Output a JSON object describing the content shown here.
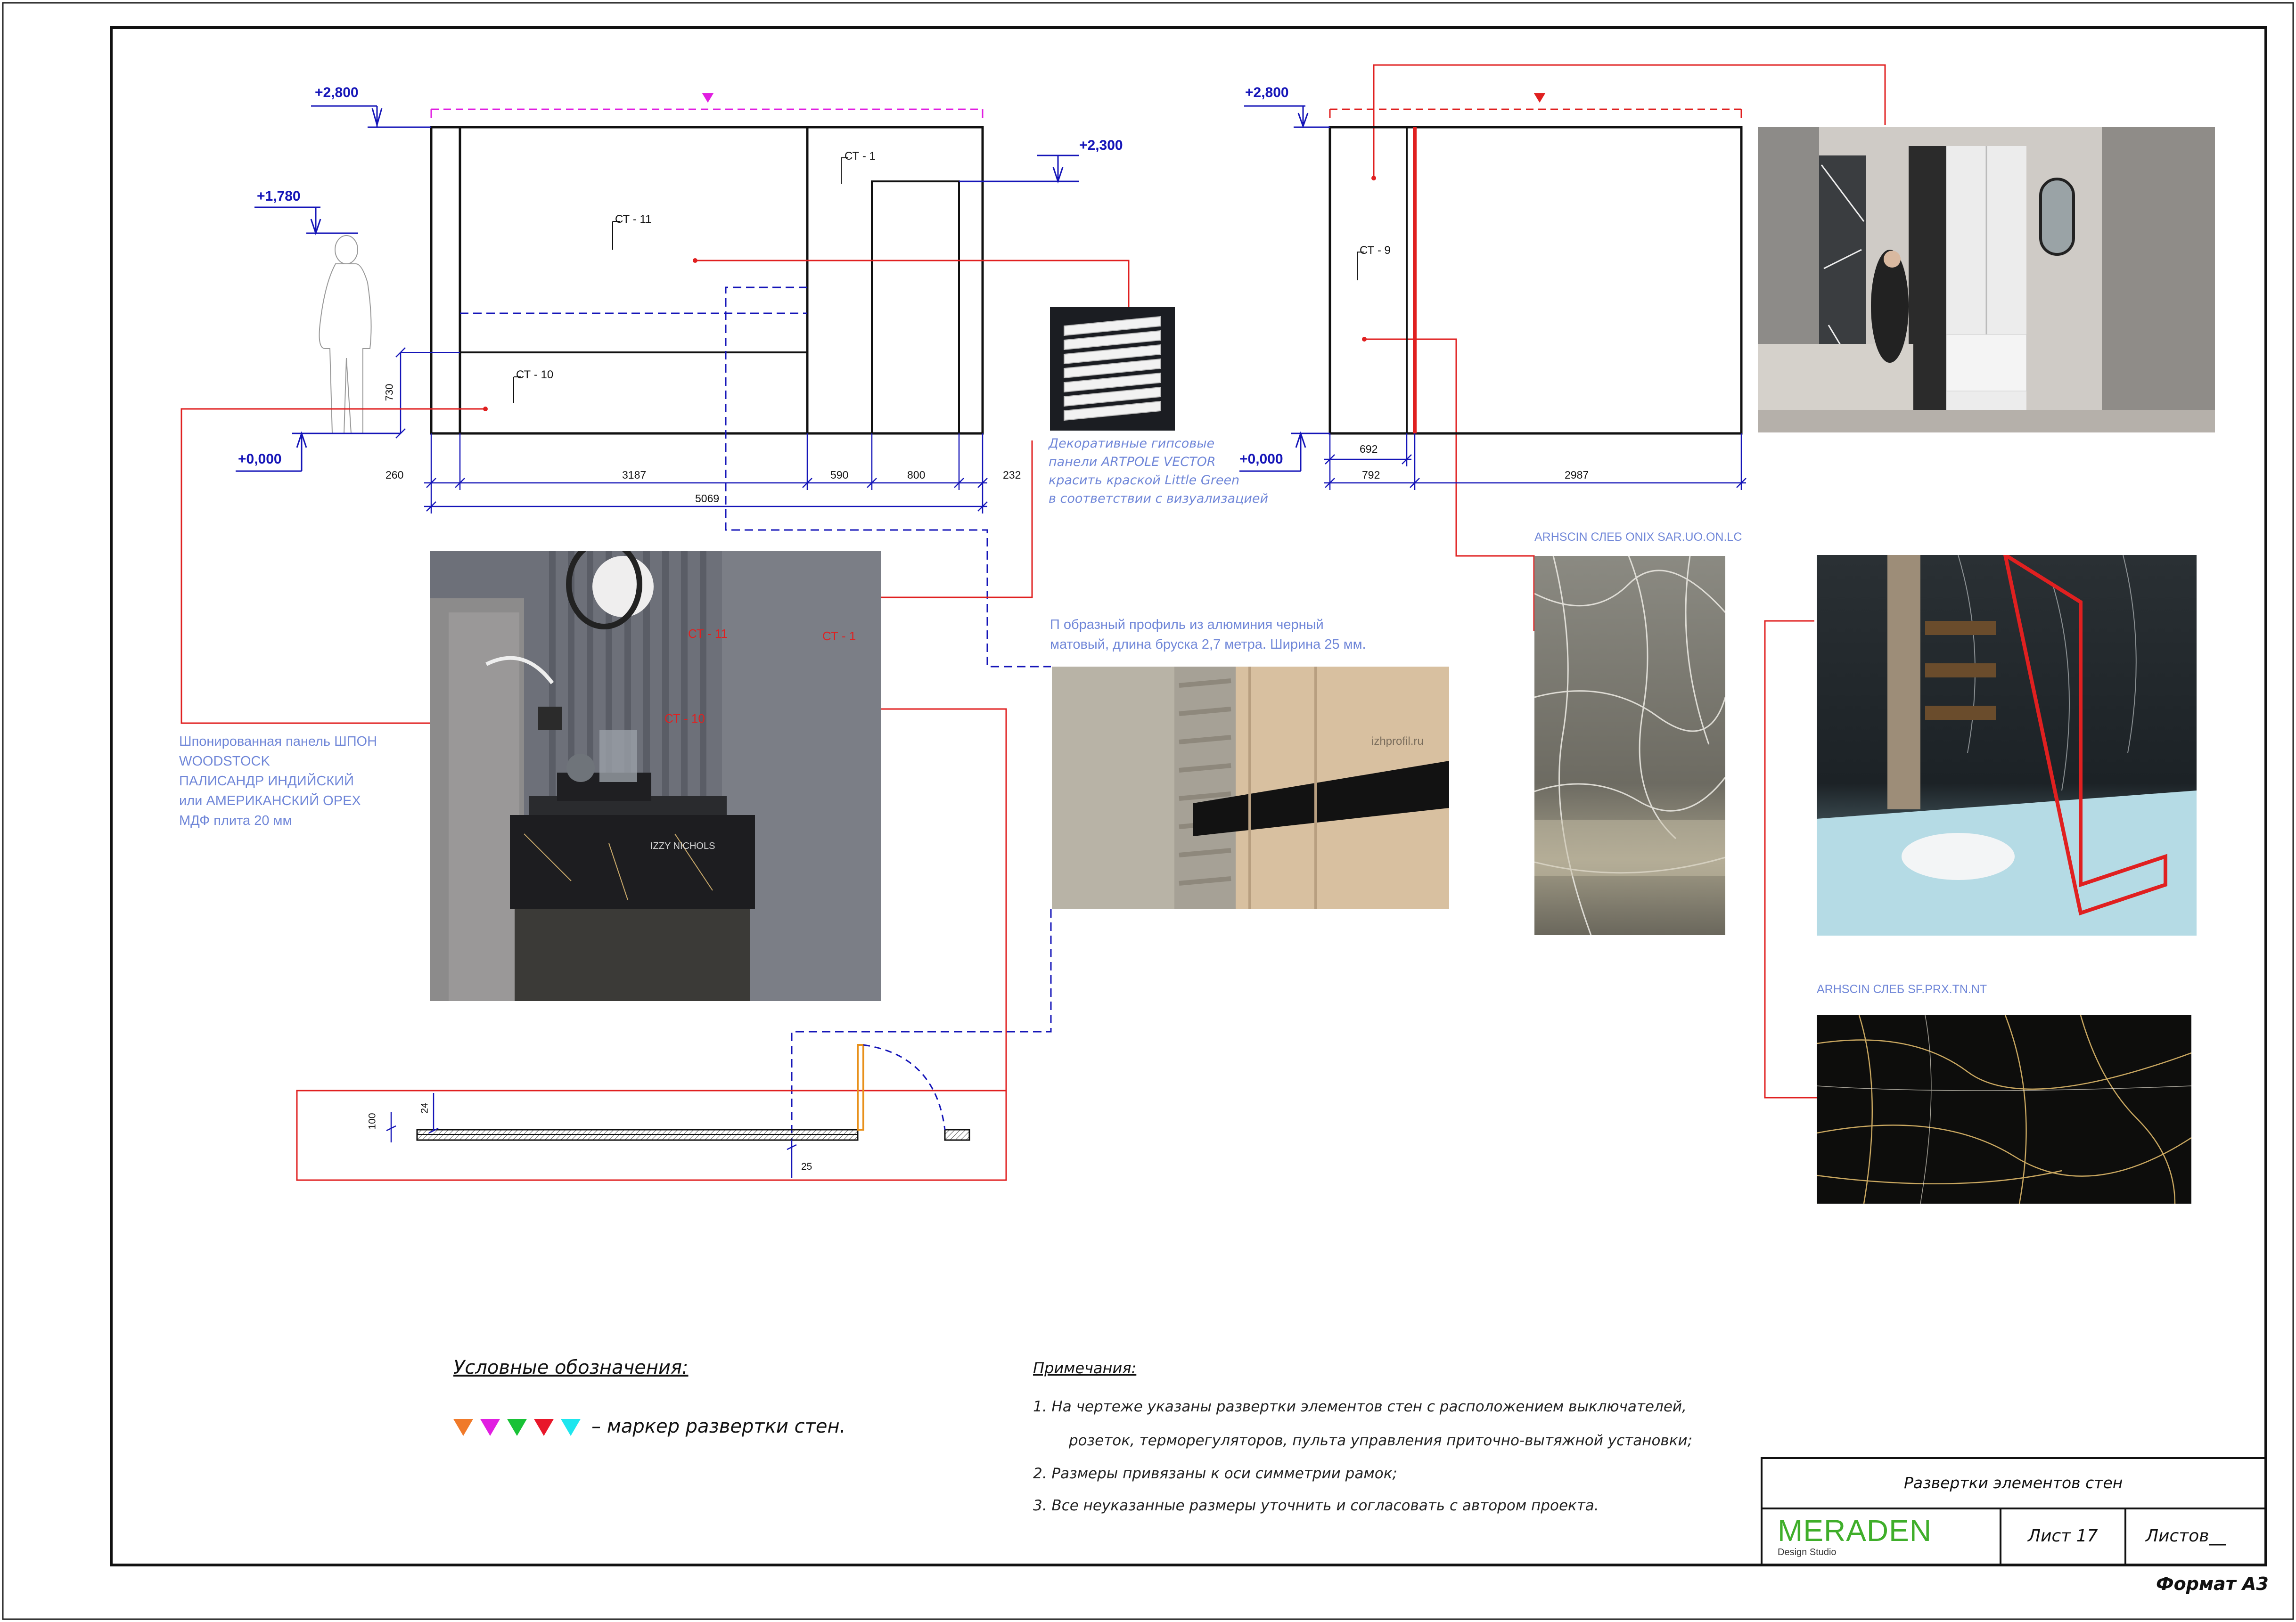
{
  "elevation_a": {
    "levels": {
      "top": "+2,800",
      "door": "+2,300",
      "figure": "+1,780",
      "floor": "+0,000"
    },
    "tags": {
      "ct11": "СТ - 11",
      "ct1": "СТ - 1",
      "ct10": "СТ - 10"
    },
    "dims_row1": [
      "260",
      "3187",
      "590",
      "800",
      "232"
    ],
    "dims_total": "5069",
    "dim_vertical": "730"
  },
  "elevation_b": {
    "levels": {
      "top": "+2,800",
      "floor": "+0,000"
    },
    "tags": {
      "ct9": "СТ - 9"
    },
    "dims_row1": [
      "692"
    ],
    "dims_row2": [
      "792",
      "2987"
    ]
  },
  "annotations": {
    "gypsum_panels": [
      "Декоративные гипсовые",
      "панели ARTPOLE VECTOR",
      "красить краской Little Green",
      "в соответствии с визуализацией"
    ],
    "aluminium_profile": [
      "П образный профиль из алюминия черный",
      "матовый, длина бруска 2,7 метра. Ширина 25 мм."
    ],
    "veneer_panel": [
      "Шпонированная панель ШПОН",
      "WOODSTOCK",
      "ПАЛИСАНДР ИНДИЙСКИЙ",
      "или АМЕРИКАНСКИЙ ОРЕХ",
      "МДФ плита 20 мм"
    ],
    "slab_onix": "ARHSCIN СЛЕБ ONIX SAR.UO.ON.LC",
    "slab_sf": "ARHSCIN СЛЕБ SF.PRX.TN.NT"
  },
  "render_tags": {
    "ct11": "СТ - 11",
    "ct10": "СТ - 10",
    "ct1": "СТ - 1"
  },
  "photo_watermarks": {
    "profile": "izhprofil.ru",
    "book": "IZZY NICHOLS"
  },
  "plan": {
    "dims": [
      "100",
      "24",
      "25"
    ]
  },
  "legend": {
    "title": "Условные обозначения:",
    "text": "– маркер развертки стен.",
    "marker_colors": [
      "#f07a2a",
      "#e11ee1",
      "#18c236",
      "#e8172a",
      "#1ee6ee"
    ]
  },
  "notes": {
    "title": "Примечания:",
    "items": [
      "1.      На чертеже указаны развертки элементов стен с расположением выключателей,",
      "розеток, терморегуляторов, пульта управления приточно-вытяжной установки;",
      "2.     Размеры привязаны к оси симметрии рамок;",
      "3.    Все неуказанные размеры уточнить и согласовать с автором проекта."
    ]
  },
  "title_block": {
    "title": "Развертки элементов стен",
    "company": "MERADEN",
    "company_sub": "Design Studio",
    "sheet": "Лист 17",
    "sheets": "Листов__",
    "format": "Формат А3"
  },
  "colors": {
    "dim_blue": "#1515b8",
    "leader_red": "#e02020",
    "note_blue": "#6f86d8",
    "brand_green": "#3fae2a",
    "marker_magenta": "#e11ee1"
  }
}
